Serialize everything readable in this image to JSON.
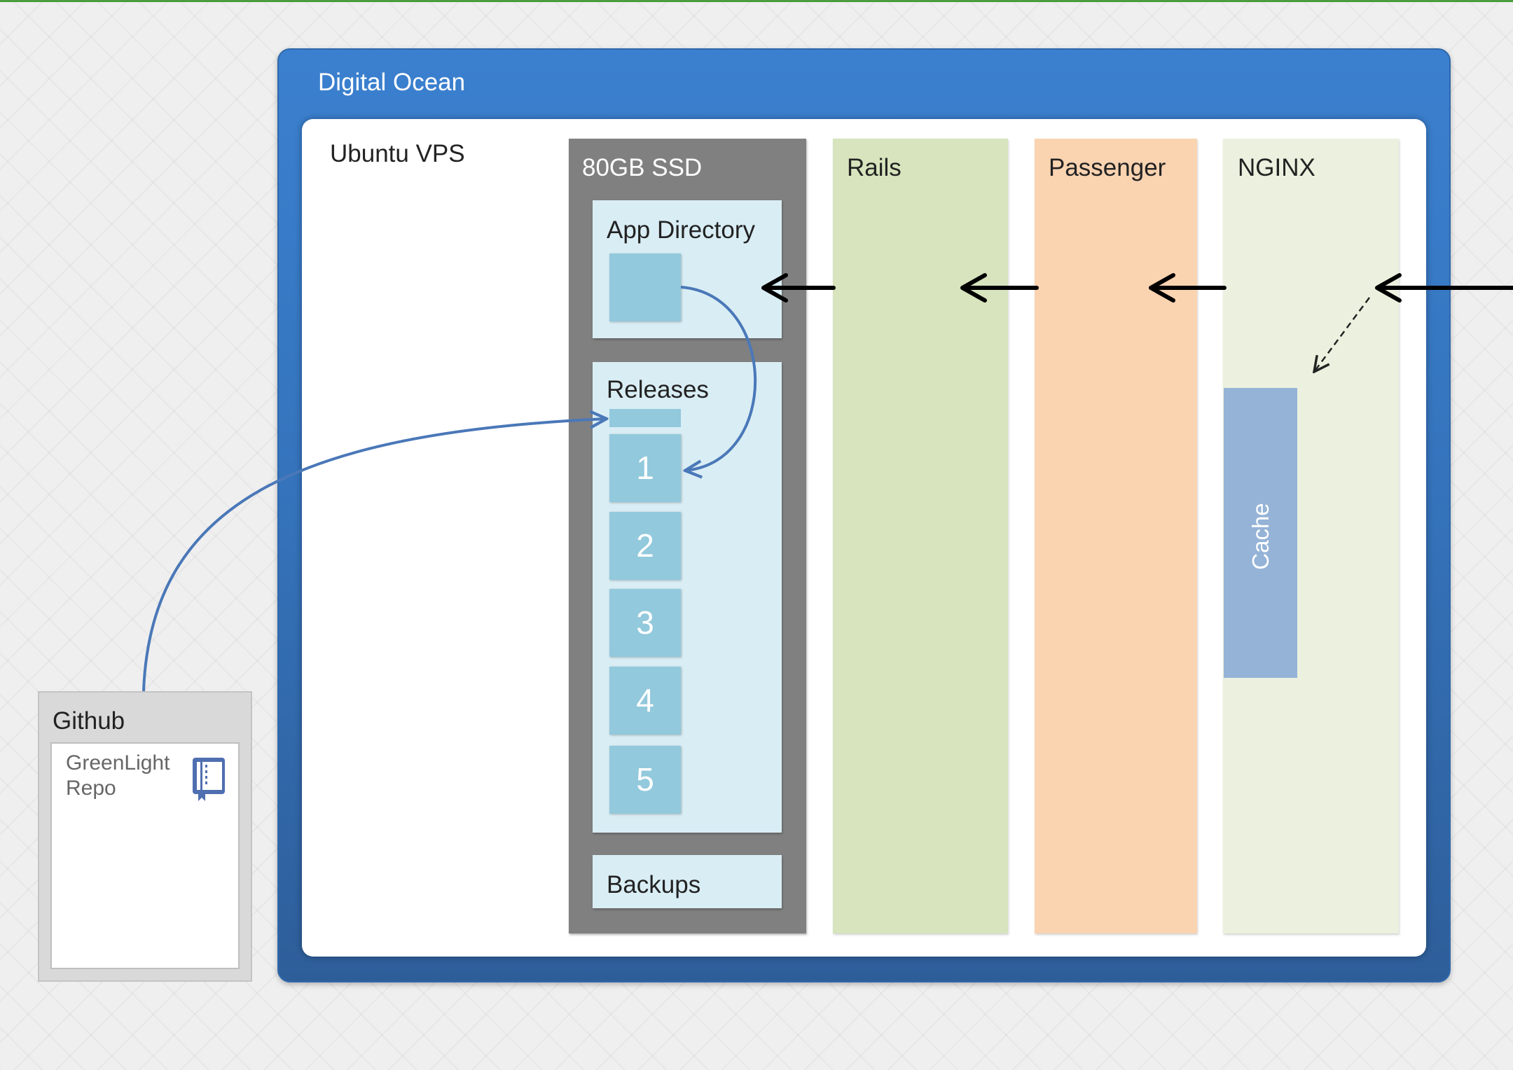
{
  "title": "Digital Ocean",
  "server": {
    "label": "Ubuntu VPS"
  },
  "storage": {
    "label": "80GB SSD",
    "app_directory": "App Directory",
    "releases": {
      "label": "Releases",
      "items": [
        "1",
        "2",
        "3",
        "4",
        "5"
      ]
    },
    "backups": "Backups"
  },
  "services": [
    {
      "label": "Rails",
      "color": "#d7e4bd"
    },
    {
      "label": "Passenger",
      "color": "#fad3b1"
    },
    {
      "label": "NGINX",
      "color": "#ebf1de"
    }
  ],
  "cache": {
    "label": "Cache",
    "color": "#95b3d7"
  },
  "github": {
    "label": "Github",
    "repo": "GreenLight Repo",
    "icon": "repo-book-icon"
  },
  "colors": {
    "ocean": "#3b80cf",
    "disk": "#808080",
    "pane": "#d9edf4",
    "box": "#92c9dc",
    "connector": "#4a78b8"
  }
}
